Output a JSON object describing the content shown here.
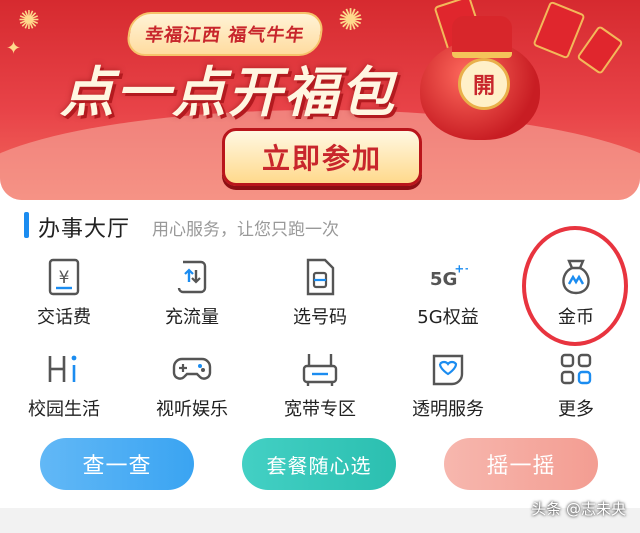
{
  "banner": {
    "slogan": "幸福江西 福气牛年",
    "headline": "点一点开福包",
    "bag_char": "開",
    "join_button": "立即参加",
    "colors": {
      "red": "#d62a2f",
      "gold": "#ffd98c"
    }
  },
  "section": {
    "title": "办事大厅",
    "subtitle": "用心服务，让您只跑一次",
    "accent": "#1b8cf0"
  },
  "services": [
    {
      "label": "交话费",
      "icon": "bill-yuan-icon"
    },
    {
      "label": "充流量",
      "icon": "data-traffic-icon"
    },
    {
      "label": "选号码",
      "icon": "sim-card-icon"
    },
    {
      "label": "5G权益",
      "icon": "5g-plus-icon"
    },
    {
      "label": "金币",
      "icon": "coin-bag-icon"
    },
    {
      "label": "校园生活",
      "icon": "campus-hi-icon"
    },
    {
      "label": "视听娱乐",
      "icon": "gamepad-icon"
    },
    {
      "label": "宽带专区",
      "icon": "router-icon"
    },
    {
      "label": "透明服务",
      "icon": "transparent-service-icon"
    },
    {
      "label": "更多",
      "icon": "more-grid-icon"
    }
  ],
  "actions": {
    "check": "查一查",
    "plan": "套餐随心选",
    "shake": "摇一摇"
  },
  "watermark": "头条 @志未央"
}
